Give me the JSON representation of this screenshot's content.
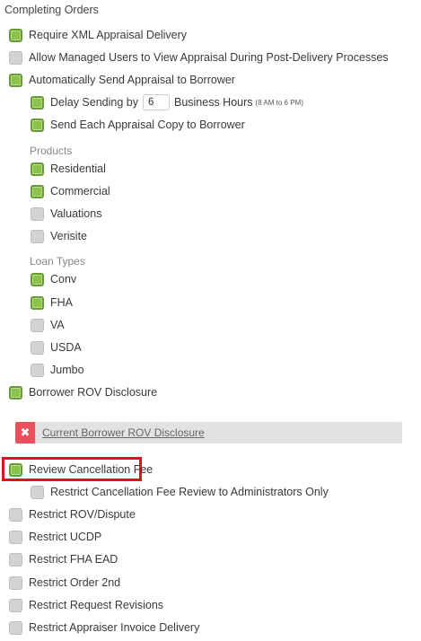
{
  "section_title": "Completing Orders",
  "options": {
    "require_xml": {
      "label": "Require XML Appraisal Delivery",
      "checked": true
    },
    "allow_managed_users": {
      "label": "Allow Managed Users to View Appraisal During Post-Delivery Processes",
      "checked": false
    },
    "auto_send": {
      "label": "Automatically Send Appraisal to Borrower",
      "checked": true
    },
    "delay_sending": {
      "label_before": "Delay Sending by",
      "value": "6",
      "label_after": "Business Hours",
      "note": "(8 AM to 6 PM)",
      "checked": true
    },
    "send_each_copy": {
      "label": "Send Each Appraisal Copy to Borrower",
      "checked": true
    },
    "borrower_rov": {
      "label": "Borrower ROV Disclosure",
      "checked": true
    },
    "review_cancellation_fee": {
      "label": "Review Cancellation Fee",
      "checked": true
    },
    "restrict_cancellation_admin": {
      "label": "Restrict Cancellation Fee Review to Administrators Only",
      "checked": false
    },
    "restrict_rov": {
      "label": "Restrict ROV/Dispute",
      "checked": false
    },
    "restrict_ucdp": {
      "label": "Restrict UCDP",
      "checked": false
    },
    "restrict_fha_ead": {
      "label": "Restrict FHA EAD",
      "checked": false
    },
    "restrict_order_2nd": {
      "label": "Restrict Order 2nd",
      "checked": false
    },
    "restrict_request_revisions": {
      "label": "Restrict Request Revisions",
      "checked": false
    },
    "restrict_invoice_delivery": {
      "label": "Restrict Appraiser Invoice Delivery",
      "checked": false
    }
  },
  "products": {
    "title": "Products",
    "items": [
      {
        "label": "Residential",
        "checked": true
      },
      {
        "label": "Commercial",
        "checked": true
      },
      {
        "label": "Valuations",
        "checked": false
      },
      {
        "label": "Verisite",
        "checked": false
      }
    ]
  },
  "loan_types": {
    "title": "Loan Types",
    "items": [
      {
        "label": "Conv",
        "checked": true
      },
      {
        "label": "FHA",
        "checked": true
      },
      {
        "label": "VA",
        "checked": false
      },
      {
        "label": "USDA",
        "checked": false
      },
      {
        "label": "Jumbo",
        "checked": false
      }
    ]
  },
  "rov_document": {
    "link_text": "Current Borrower ROV Disclosure",
    "remove_icon": "close-icon"
  },
  "colors": {
    "checked": "#8bc34a",
    "unchecked": "#d3d3d3",
    "highlight": "#e0121f",
    "remove": "#e9505a"
  }
}
